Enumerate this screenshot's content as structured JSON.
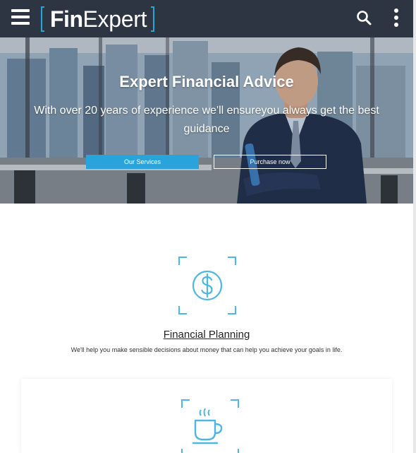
{
  "header": {
    "logo_bold": "Fin",
    "logo_light": "Expert",
    "menu_icon": "hamburger-menu-icon",
    "search_icon": "search-icon",
    "more_icon": "more-vertical-icon",
    "bg_color": "#2e3542",
    "accent_color": "#29a3dc"
  },
  "hero": {
    "title": "Expert Financial Advice",
    "subtitle": "With over 20 years of experience we'll ensureyou always get the best guidance",
    "primary_button": "Our Services",
    "secondary_button": "Purchase now"
  },
  "services": [
    {
      "icon": "dollar-circle-icon",
      "title": "Financial Planning",
      "description": "We'll help you make sensible decisions about money that can help you achieve your goals in life."
    },
    {
      "icon": "coffee-cup-icon"
    }
  ]
}
